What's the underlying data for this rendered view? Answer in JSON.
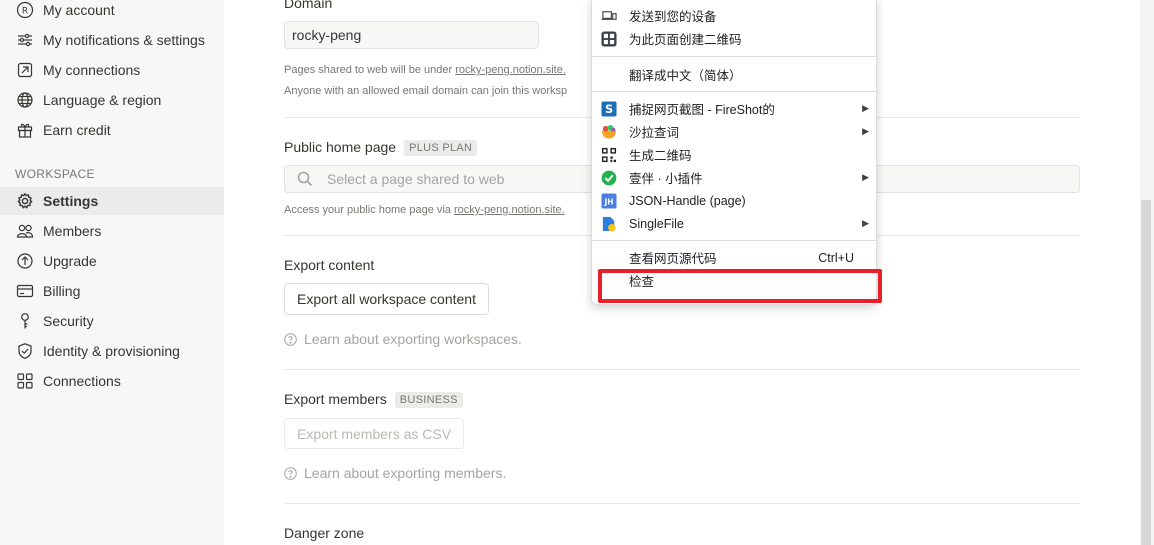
{
  "sidebar": {
    "items_top": [
      {
        "label": "My account",
        "icon": "account-icon"
      },
      {
        "label": "My notifications & settings",
        "icon": "sliders-icon"
      },
      {
        "label": "My connections",
        "icon": "connections-icon"
      },
      {
        "label": "Language & region",
        "icon": "globe-icon"
      },
      {
        "label": "Earn credit",
        "icon": "gift-icon"
      }
    ],
    "section_label": "WORKSPACE",
    "items_workspace": [
      {
        "label": "Settings",
        "icon": "gear-icon"
      },
      {
        "label": "Members",
        "icon": "people-icon"
      },
      {
        "label": "Upgrade",
        "icon": "upgrade-icon"
      },
      {
        "label": "Billing",
        "icon": "card-icon"
      },
      {
        "label": "Security",
        "icon": "key-icon"
      },
      {
        "label": "Identity & provisioning",
        "icon": "shield-icon"
      },
      {
        "label": "Connections",
        "icon": "grid-icon"
      }
    ]
  },
  "main": {
    "domain_label": "Domain",
    "domain_value": "rocky-peng",
    "domain_hint_1_prefix": "Pages shared to web will be under",
    "domain_hint_1_link": "rocky-peng.notion.site.",
    "domain_hint_2": "Anyone with an allowed email domain can join this worksp",
    "public_home_label": "Public home page",
    "public_home_tag": "PLUS PLAN",
    "public_home_placeholder": "Select a page shared to web",
    "public_home_hint_prefix": "Access your public home page via",
    "public_home_hint_link": "rocky-peng.notion.site.",
    "export_content_label": "Export content",
    "export_content_button": "Export all workspace content",
    "export_content_learn": "Learn about exporting workspaces.",
    "export_members_label": "Export members",
    "export_members_tag": "BUSINESS",
    "export_members_button": "Export members as CSV",
    "export_members_learn": "Learn about exporting members.",
    "danger_zone_label": "Danger zone"
  },
  "context_menu": {
    "items": [
      {
        "label": "发送到您的设备",
        "icon": "send-device-icon"
      },
      {
        "label": "为此页面创建二维码",
        "icon": "qr-create-icon"
      },
      {
        "label": "翻译成中文（简体）",
        "icon": ""
      },
      {
        "label": "捕捉网页截图 - FireShot的",
        "icon": "fireshot-icon",
        "submenu": true
      },
      {
        "label": "沙拉查词",
        "icon": "saladict-icon",
        "submenu": true
      },
      {
        "label": "生成二维码",
        "icon": "qr-icon"
      },
      {
        "label": "壹伴 · 小插件",
        "icon": "yiban-icon",
        "submenu": true
      },
      {
        "label": "JSON-Handle (page)",
        "icon": "json-handle-icon"
      },
      {
        "label": "SingleFile",
        "icon": "singlefile-icon",
        "submenu": true
      },
      {
        "label": "查看网页源代码",
        "icon": "",
        "shortcut": "Ctrl+U"
      },
      {
        "label": "检查",
        "icon": ""
      }
    ],
    "highlight_color": "#e8202a"
  }
}
